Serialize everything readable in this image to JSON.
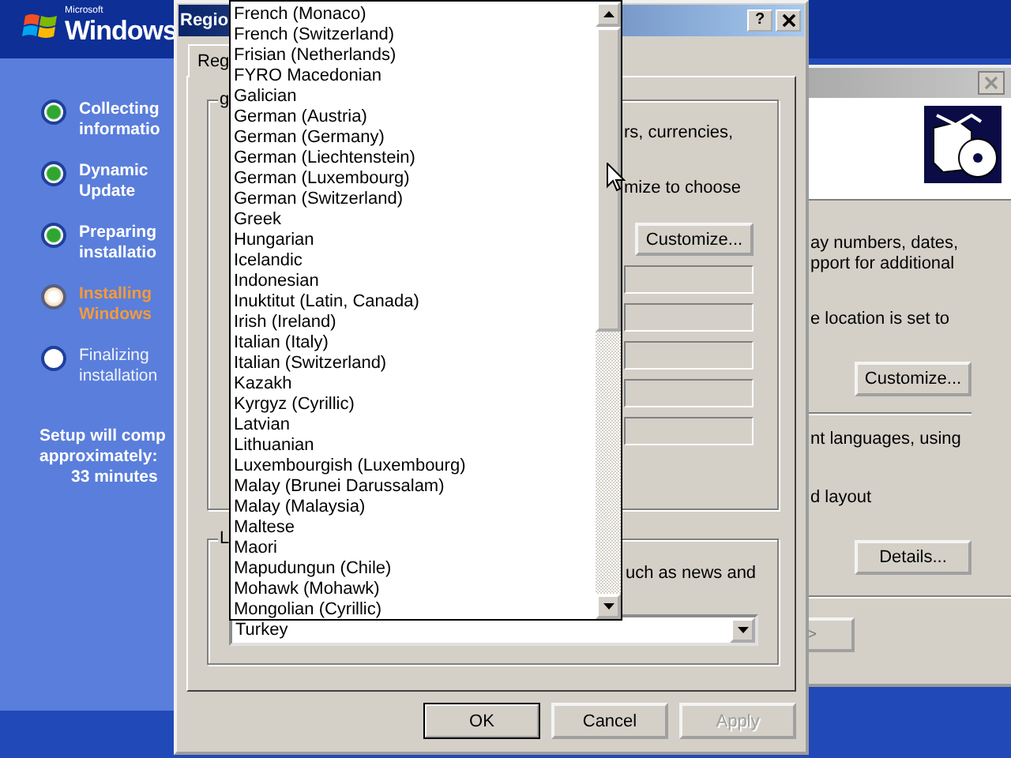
{
  "setup": {
    "logo": {
      "maker": "Microsoft",
      "name": "Windows"
    },
    "steps": [
      {
        "lines": [
          "Collecting",
          "informatio"
        ],
        "completed": true,
        "active": false
      },
      {
        "lines": [
          "Dynamic",
          "Update"
        ],
        "completed": true,
        "active": false
      },
      {
        "lines": [
          "Preparing",
          "installatio"
        ],
        "completed": true,
        "active": false
      },
      {
        "lines": [
          "Installing",
          "Windows"
        ],
        "completed": false,
        "active": true
      },
      {
        "lines": [
          "Finalizing",
          "installation"
        ],
        "completed": false,
        "active": false
      }
    ],
    "estimate": [
      "Setup will comp",
      "approximately:",
      "33 minutes"
    ]
  },
  "wizard": {
    "region_text": [
      "ay numbers, dates,",
      "pport for additional"
    ],
    "location_text": "e location is set to",
    "customize_button": "Customize...",
    "languages_text": "nt languages, using",
    "layout_text": "d layout",
    "details_button": "Details...",
    "next_button": ">"
  },
  "regional_dialog": {
    "title": "Regio",
    "help_button": "?",
    "tabs": [
      {
        "label": "Reg",
        "selected": true
      }
    ],
    "format_group": {
      "label": "g",
      "text_1": "rs, currencies,",
      "text_2": "mize to choose",
      "customize_button": "Customize..."
    },
    "location_group": {
      "label": "L",
      "text": "uch as news and",
      "location": "Turkey"
    },
    "language_list": {
      "items": [
        "French (Monaco)",
        "French (Switzerland)",
        "Frisian (Netherlands)",
        "FYRO Macedonian",
        "Galician",
        "German (Austria)",
        "German (Germany)",
        "German (Liechtenstein)",
        "German (Luxembourg)",
        "German (Switzerland)",
        "Greek",
        "Hungarian",
        "Icelandic",
        "Indonesian",
        "Inuktitut (Latin, Canada)",
        "Irish (Ireland)",
        "Italian (Italy)",
        "Italian (Switzerland)",
        "Kazakh",
        "Kyrgyz (Cyrillic)",
        "Latvian",
        "Lithuanian",
        "Luxembourgish (Luxembourg)",
        "Malay (Brunei Darussalam)",
        "Malay (Malaysia)",
        "Maltese",
        "Maori",
        "Mapudungun (Chile)",
        "Mohawk (Mohawk)",
        "Mongolian (Cyrillic)"
      ]
    },
    "buttons": [
      {
        "label": "OK",
        "default": true,
        "disabled": false
      },
      {
        "label": "Cancel",
        "default": false,
        "disabled": false
      },
      {
        "label": "Apply",
        "default": false,
        "disabled": true
      }
    ]
  }
}
